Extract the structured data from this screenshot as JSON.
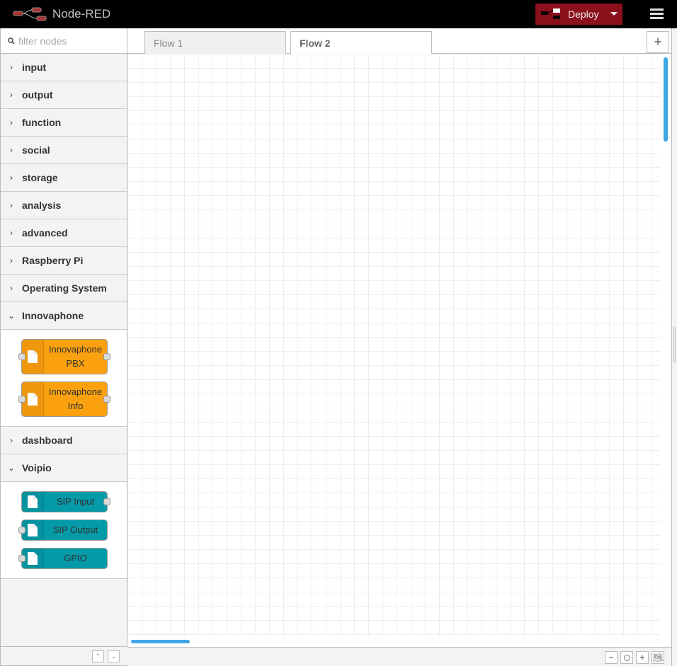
{
  "header": {
    "title": "Node-RED",
    "deploy_label": "Deploy"
  },
  "palette": {
    "search_placeholder": "filter nodes",
    "categories": [
      "input",
      "output",
      "function",
      "social",
      "storage",
      "analysis",
      "advanced",
      "Raspberry Pi",
      "Operating System",
      "Innovaphone",
      "dashboard",
      "Voipio"
    ],
    "innovaphone_nodes": [
      {
        "line1": "Innovaphone",
        "line2": "PBX"
      },
      {
        "line1": "Innovaphone",
        "line2": "Info"
      }
    ],
    "voipio_nodes": [
      "SIP Input",
      "SIP Output",
      "GPIO"
    ]
  },
  "tabs": [
    {
      "label": "Flow 1"
    },
    {
      "label": "Flow 2"
    }
  ],
  "colors": {
    "innovaphone": "#fba00e",
    "voipio": "#049aa8",
    "deploy": "#8c101c",
    "scrollbar": "#3ea7e6"
  }
}
